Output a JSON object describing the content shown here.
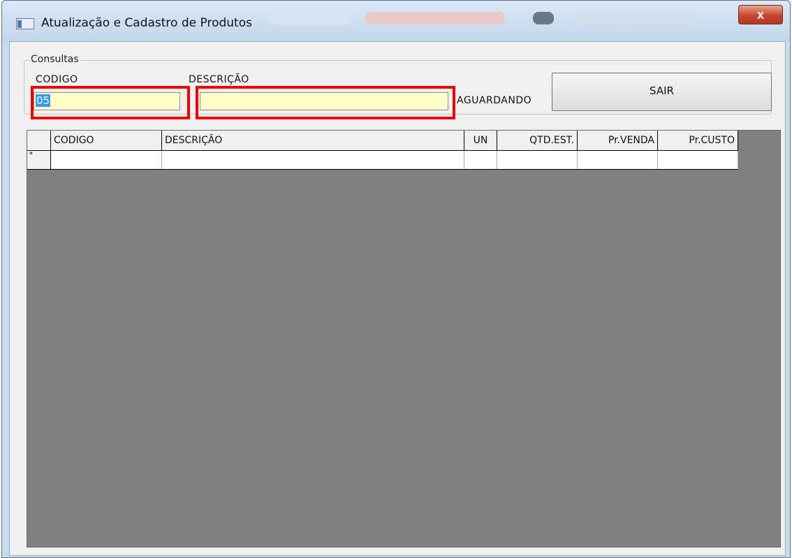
{
  "window": {
    "title": "Atualização e Cadastro de Produtos",
    "close_label": "x"
  },
  "consultas": {
    "group_label": "Consultas",
    "codigo_label": "CODIGO",
    "descricao_label": "DESCRIÇÃO",
    "codigo_value": "05",
    "descricao_value": "",
    "status_text": "AGUARDANDO",
    "sair_label": "SAIR"
  },
  "grid": {
    "columns": [
      "CODIGO",
      "DESCRIÇÃO",
      "UN",
      "QTD.EST.",
      "Pr.VENDA",
      "Pr.CUSTO"
    ],
    "new_row_marker": "*"
  },
  "colors": {
    "input_bg": "#ffffc8",
    "highlight_border": "#ee0000",
    "selection": "#3399ff",
    "grid_bg": "#808080"
  }
}
